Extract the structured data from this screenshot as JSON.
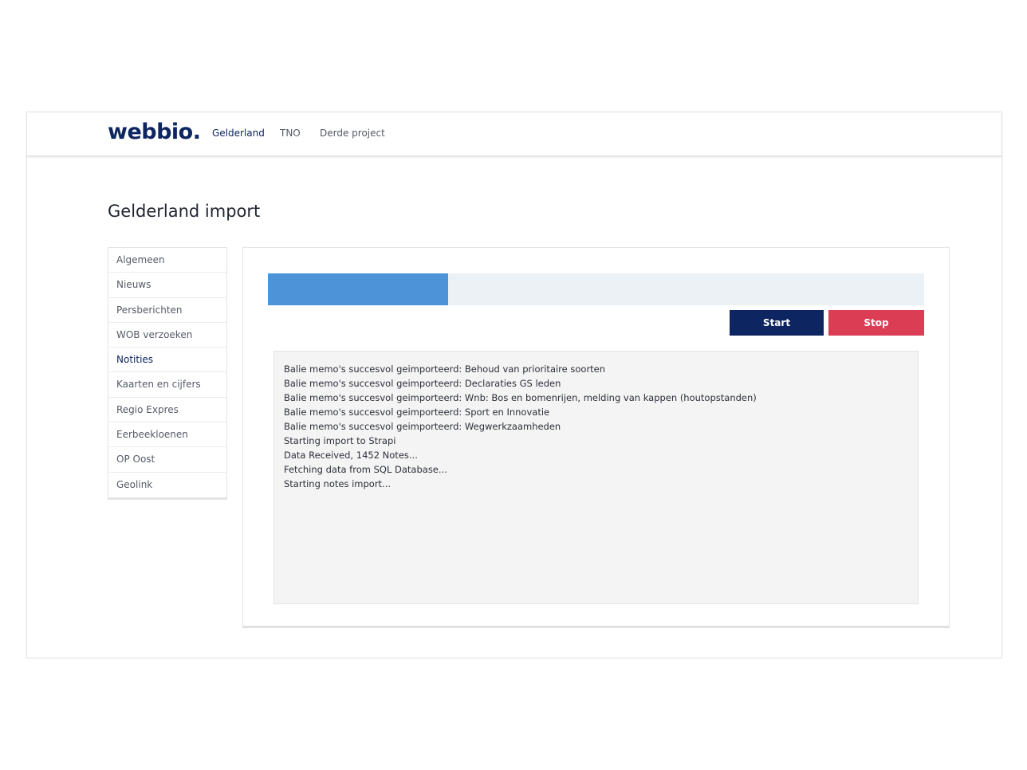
{
  "brand": {
    "logo_text": "webbio."
  },
  "nav": {
    "links": [
      {
        "label": "Gelderland",
        "active": true
      },
      {
        "label": "TNO",
        "active": false
      },
      {
        "label": "Derde project",
        "active": false
      }
    ]
  },
  "page": {
    "title": "Gelderland import"
  },
  "sidebar": {
    "items": [
      {
        "label": "Algemeen"
      },
      {
        "label": "Nieuws"
      },
      {
        "label": "Persberichten"
      },
      {
        "label": "WOB verzoeken"
      },
      {
        "label": "Notities",
        "active": true
      },
      {
        "label": "Kaarten en cijfers"
      },
      {
        "label": "Regio Expres"
      },
      {
        "label": "Eerbeekloenen"
      },
      {
        "label": "OP Oost"
      },
      {
        "label": "Geolink"
      }
    ]
  },
  "import": {
    "progress_fraction": 0.275,
    "start_label": "Start",
    "stop_label": "Stop",
    "log_lines": [
      "Balie memo's succesvol geimporteerd: Behoud van prioritaire soorten",
      "Balie memo's succesvol geimporteerd: Declaraties GS leden",
      "Balie memo's succesvol geimporteerd: Wnb: Bos en bomenrijen, melding van kappen (houtopstanden)",
      "Balie memo's succesvol geimporteerd: Sport en Innovatie",
      "Balie memo's succesvol geimporteerd: Wegwerkzaamheden",
      "Starting import to Strapi",
      "Data Received, 1452 Notes...",
      "Fetching data from SQL Database...",
      "Starting notes import..."
    ]
  },
  "colors": {
    "brand_navy": "#0d2560",
    "progress_blue": "#4c93d7",
    "stop_red": "#db3d55"
  }
}
